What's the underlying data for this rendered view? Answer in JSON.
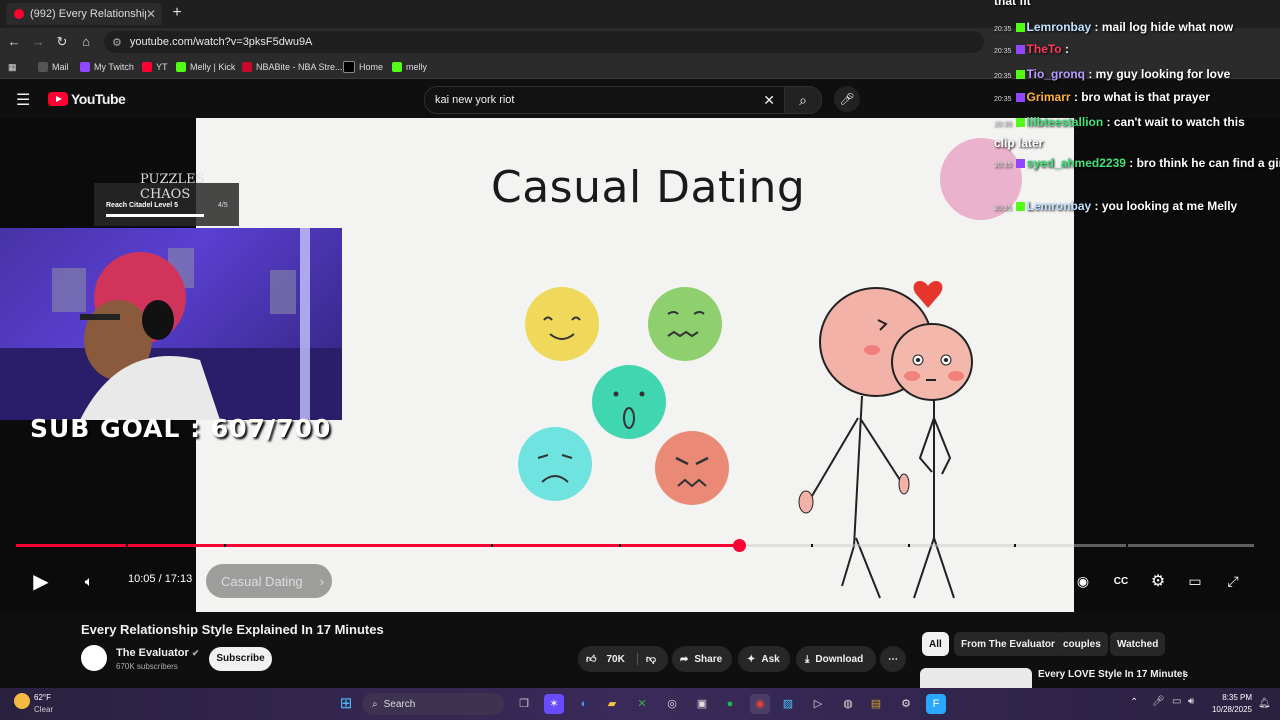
{
  "browser": {
    "tab_title": "(992) Every Relationship Style E",
    "url": "youtube.com/watch?v=3pksF5dwu9A",
    "bookmarks": [
      "Mail",
      "My Twitch",
      "YT",
      "Melly | Kick",
      "NBABite - NBA Stre...",
      "Home",
      "melly"
    ]
  },
  "youtube": {
    "logo": "YouTube",
    "search_query": "kai new york riot"
  },
  "video": {
    "slide_title": "Casual Dating",
    "time": "10:05 / 17:13",
    "chapter": "Casual Dating",
    "progress_fraction": 0.585
  },
  "stream_overlay": {
    "sub_goal": "SUB GOAL : 607/700",
    "quest_logo": "PUZZLES CHAOS",
    "quest_text": "Reach Citadel Level 5",
    "quest_count": "4/5"
  },
  "chat": [
    {
      "time": "",
      "user": "",
      "user_color": "#ffffff",
      "message": "that fit"
    },
    {
      "time": "20:35",
      "user": "Lemronbay",
      "user_color": "#bfe0ff",
      "message": ": mail log hide what now"
    },
    {
      "time": "20:35",
      "user": "TheTo",
      "user_color": "#ff3b5c",
      "message": ":"
    },
    {
      "time": "20:35",
      "user": "Tio_gronq",
      "user_color": "#b79cff",
      "message": ": my guy looking for love"
    },
    {
      "time": "20:35",
      "user": "Grimarr",
      "user_color": "#ffb03b",
      "message": ": bro what is that prayer"
    },
    {
      "time": "20:35",
      "user": "lilbteestallion",
      "user_color": "#43e27a",
      "message": ": can't wait to watch this clip later"
    },
    {
      "time": "20:35",
      "user": "syed_ahmed2239",
      "user_color": "#43e27a",
      "message": ": bro think he can find a girl"
    },
    {
      "time": "20:35",
      "user": "Lemronbay",
      "user_color": "#bfe0ff",
      "message": ": you looking at me Melly"
    }
  ],
  "below": {
    "title": "Every Relationship Style Explained In 17 Minutes",
    "channel": "The Evaluator",
    "subscribers": "670K subscribers",
    "subscribe": "Subscribe",
    "likes": "70K",
    "share": "Share",
    "ask": "Ask",
    "download": "Download",
    "chips": [
      "All",
      "From The Evaluator",
      "couples",
      "Watched"
    ],
    "rec_title": "Every LOVE Style In 17 Minutes"
  },
  "taskbar": {
    "weather_temp": "62°F",
    "weather_desc": "Clear",
    "search": "Search",
    "clock_time": "8:35 PM",
    "clock_date": "10/28/2025"
  }
}
